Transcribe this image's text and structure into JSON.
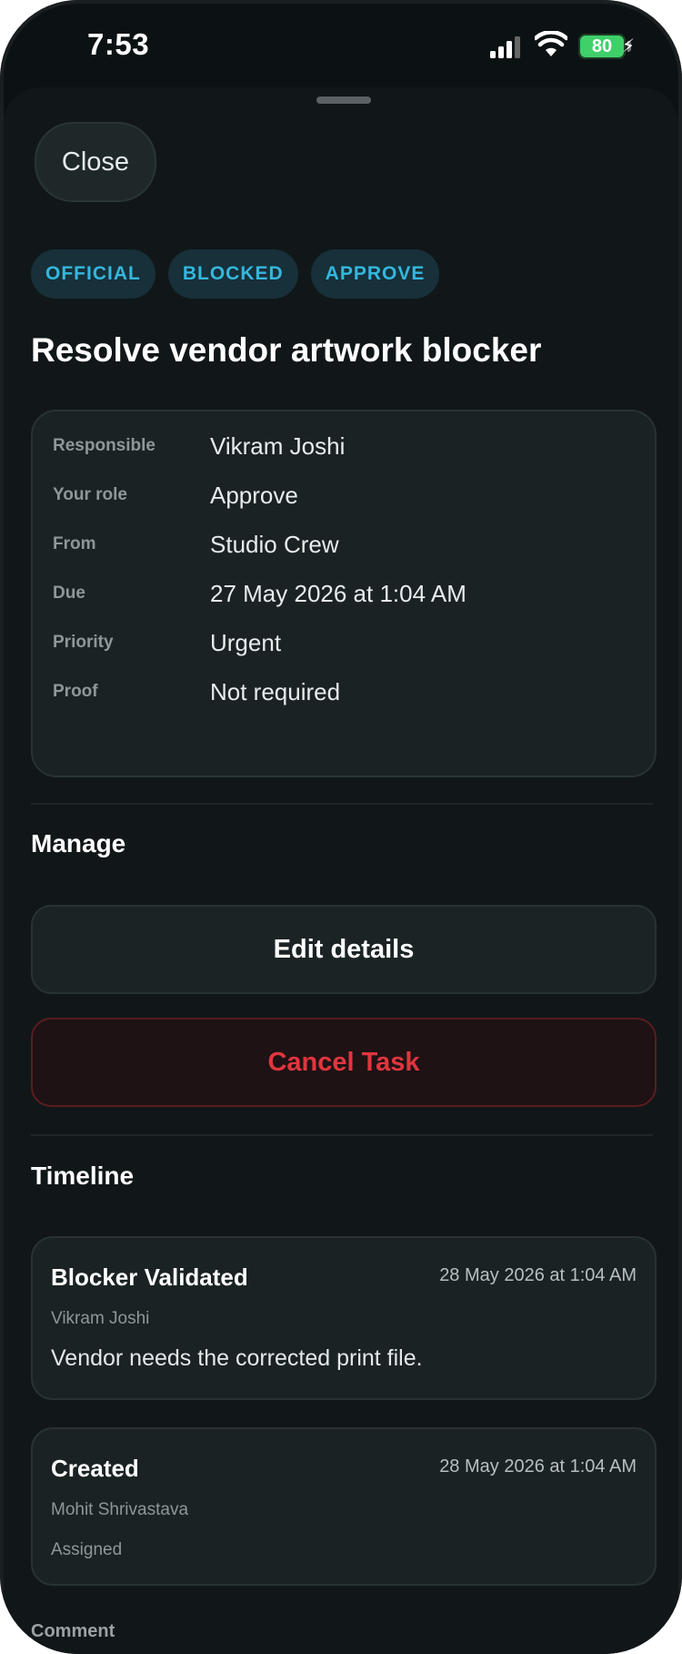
{
  "status_bar": {
    "time": "7:53",
    "battery": "80"
  },
  "header": {
    "close_label": "Close"
  },
  "tags": [
    "OFFICIAL",
    "BLOCKED",
    "APPROVE"
  ],
  "task": {
    "title": "Resolve vendor artwork blocker"
  },
  "details": [
    {
      "label": "Responsible",
      "value": "Vikram Joshi"
    },
    {
      "label": "Your role",
      "value": "Approve"
    },
    {
      "label": "From",
      "value": "Studio Crew"
    },
    {
      "label": "Due",
      "value": "27 May 2026 at 1:04 AM"
    },
    {
      "label": "Priority",
      "value": "Urgent"
    },
    {
      "label": "Proof",
      "value": "Not required"
    }
  ],
  "manage": {
    "title": "Manage",
    "edit_label": "Edit details",
    "cancel_label": "Cancel Task"
  },
  "timeline": {
    "title": "Timeline",
    "events": [
      {
        "title": "Blocker Validated",
        "date": "28 May 2026 at 1:04 AM",
        "user": "Vikram Joshi",
        "body": "Vendor needs the corrected print file."
      },
      {
        "title": "Created",
        "date": "28 May 2026 at 1:04 AM",
        "user": "Mohit Shrivastava",
        "body": "Assigned"
      }
    ]
  },
  "comment": {
    "label": "Comment"
  },
  "colors": {
    "accent": "#35b7de",
    "danger": "#e0363e",
    "battery": "#3fd06a"
  }
}
